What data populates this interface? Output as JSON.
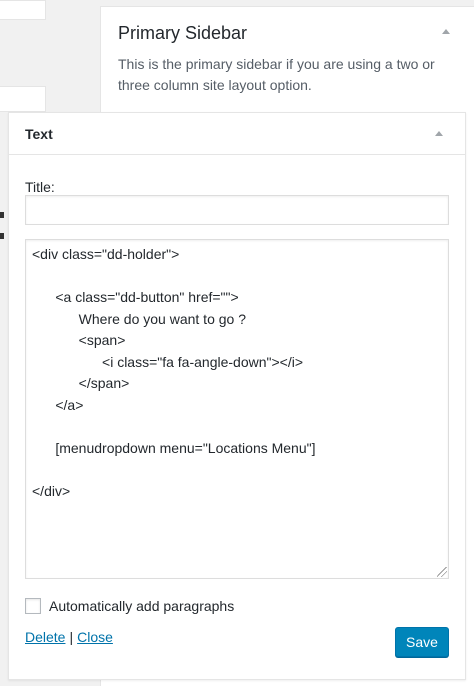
{
  "sidebar": {
    "title": "Primary Sidebar",
    "description": "This is the primary sidebar if you are using a two or three column site layout option.",
    "toggle_icon": "arrow-up-icon"
  },
  "widget": {
    "title": "Text",
    "toggle_icon": "arrow-up-icon",
    "title_field_label": "Title:",
    "title_field_value": "",
    "content": "<div class=\"dd-holder\">\n\n      <a class=\"dd-button\" href=\"\">\n            Where do you want to go ?\n            <span>\n                  <i class=\"fa fa-angle-down\"></i>\n            </span>\n      </a>\n\n      [menudropdown menu=\"Locations Menu\"]\n\n</div>",
    "auto_paragraphs_label": "Automatically add paragraphs",
    "auto_paragraphs_checked": false,
    "delete_label": "Delete",
    "separator": "|",
    "close_label": "Close",
    "save_label": "Save"
  },
  "colors": {
    "accent": "#0073aa",
    "button_primary": "#0085ba",
    "background": "#f1f1f1"
  }
}
